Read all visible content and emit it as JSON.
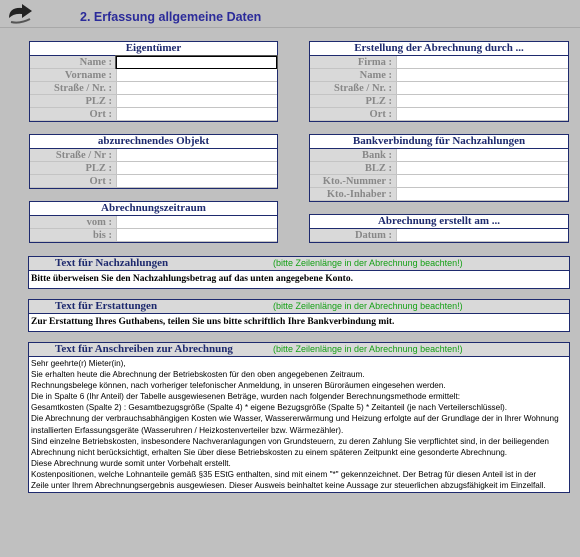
{
  "header": {
    "title": "2. Erfassung allgemeine Daten",
    "logo_icon": "curved-arrow-icon"
  },
  "eigentuemer": {
    "title": "Eigentümer",
    "fields": [
      {
        "label": "Name :",
        "value": ""
      },
      {
        "label": "Vorname :",
        "value": ""
      },
      {
        "label": "Straße / Nr. :",
        "value": ""
      },
      {
        "label": "PLZ :",
        "value": ""
      },
      {
        "label": "Ort :",
        "value": ""
      }
    ]
  },
  "ersteller": {
    "title": "Erstellung der Abrechnung durch ...",
    "fields": [
      {
        "label": "Firma :",
        "value": ""
      },
      {
        "label": "Name :",
        "value": ""
      },
      {
        "label": "Straße / Nr. :",
        "value": ""
      },
      {
        "label": "PLZ :",
        "value": ""
      },
      {
        "label": "Ort :",
        "value": ""
      }
    ]
  },
  "objekt": {
    "title": "abzurechnendes Objekt",
    "fields": [
      {
        "label": "Straße / Nr :",
        "value": ""
      },
      {
        "label": "PLZ :",
        "value": ""
      },
      {
        "label": "Ort :",
        "value": ""
      }
    ]
  },
  "bank": {
    "title": "Bankverbindung für Nachzahlungen",
    "fields": [
      {
        "label": "Bank :",
        "value": ""
      },
      {
        "label": "BLZ :",
        "value": ""
      },
      {
        "label": "Kto.-Nummer :",
        "value": ""
      },
      {
        "label": "Kto.-Inhaber :",
        "value": ""
      }
    ]
  },
  "zeitraum": {
    "title": "Abrechnungszeitraum",
    "fields": [
      {
        "label": "vom :",
        "value": ""
      },
      {
        "label": "bis :",
        "value": ""
      }
    ]
  },
  "erstellt": {
    "title": "Abrechnung erstellt am ...",
    "fields": [
      {
        "label": "Datum :",
        "value": ""
      }
    ]
  },
  "nachzahlung": {
    "title": "Text für Nachzahlungen",
    "hint": "(bitte Zeilenlänge in der Abrechnung beachten!)",
    "text": "Bitte überweisen Sie den Nachzahlungsbetrag auf das unten angegebene Konto."
  },
  "erstattung": {
    "title": "Text für Erstattungen",
    "hint": "(bitte Zeilenlänge in der Abrechnung beachten!)",
    "text": "Zur Erstattung Ihres Guthabens, teilen Sie uns bitte schriftlich Ihre Bankverbindung mit."
  },
  "anschreiben": {
    "title": "Text für Anschreiben zur Abrechnung",
    "hint": "(bitte Zeilenlänge in der Abrechnung beachten!)",
    "lines": [
      "Sehr geehrte(r)  Mieter(in),",
      "Sie erhalten heute die Abrechnung der Betriebskosten für den oben angegebenen Zeitraum.",
      "Rechnungsbelege können, nach vorheriger telefonischer Anmeldung, in unseren Büroräumen eingesehen werden.",
      "Die in Spalte 6 (Ihr Anteil) der Tabelle ausgewiesenen Beträge, wurden nach folgender Berechnungsmethode ermittelt:",
      "Gesamtkosten (Spalte 2) : Gesamtbezugsgröße (Spalte 4) * eigene Bezugsgröße (Spalte 5) * Zeitanteil (je nach Verteilerschlüssel).",
      "Die Abrechnung der verbrauchsabhängigen Kosten wie Wasser, Wassererwärmung und Heizung erfolgte auf der Grundlage der in Ihrer Wohnung",
      "installierten Erfassungsgeräte (Wasseruhren / Heizkostenverteiler bzw. Wärmezähler).",
      "Sind einzelne Betriebskosten, insbesondere Nachveranlagungen von Grundsteuern, zu deren Zahlung Sie verpflichtet sind, in der beiliegenden",
      "Abrechnung nicht berücksichtigt, erhalten Sie über diese Betriebskosten zu einem späteren Zeitpunkt eine gesonderte Abrechnung.",
      "Diese Abrechnung wurde somit unter Vorbehalt erstellt.",
      "Kostenpositionen, welche Lohnanteile gemäß §35 EStG enthalten, sind mit einem \"*\" gekennzeichnet.  Der Betrag für diesen Anteil ist in der",
      "Zeile unter Ihrem Abrechnungsergebnis ausgewiesen. Dieser Ausweis  beinhaltet keine Aussage zur steuerlichen abzugsfähigkeit im Einzelfall."
    ]
  }
}
